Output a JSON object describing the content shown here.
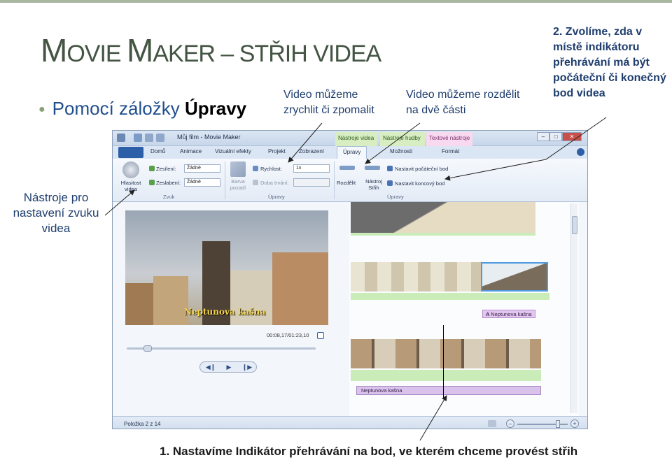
{
  "slide": {
    "title_parts": [
      "M",
      "OVIE ",
      "M",
      "AKER – ",
      "STŘIH VIDEA"
    ],
    "bullet_pre": "Pomocí záložky ",
    "bullet_bold": "Úpravy",
    "annotations": {
      "speed": "Video můžeme zrychlit či zpomalit",
      "split": "Video můžeme rozdělit na dvě části",
      "trim": "2. Zvolíme, zda v místě indikátoru přehrávání má být počáteční či konečný bod videa",
      "audio": "Nástroje pro nastavení zvuku videa",
      "playhead": "1. Nastavíme Indikátor přehrávání na bod, ve kterém chceme provést střih"
    }
  },
  "window": {
    "title": "Můj film - Movie Maker",
    "context_tabs": [
      "Nástroje videa",
      "Nástroje hudby",
      "Textové nástroje"
    ],
    "tabs": [
      "Domů",
      "Animace",
      "Vizuální efekty",
      "Projekt",
      "Zobrazení",
      "Úpravy",
      "Možnosti",
      "Formát"
    ],
    "active_tab": "Úpravy",
    "ribbon": {
      "volume_label": "Hlasitost videa",
      "fade_in_label": "Zesílení:",
      "fade_in_value": "Žádné",
      "fade_out_label": "Zeslabení:",
      "fade_out_value": "Žádné",
      "group_sound": "Zvuk",
      "bg_color_label": "Barva pozadí",
      "speed_label": "Rychlost:",
      "speed_value": "1x",
      "duration_label": "Doba trvání:",
      "group_edit": "Úpravy",
      "split_label": "Rozdělit",
      "trim_tool_label": "Nástroj Střih",
      "set_start": "Nastavit počáteční bod",
      "set_end": "Nastavit koncový bod"
    },
    "preview": {
      "caption": "Neptunova kašna",
      "timecode": "00:08,17/01:23,10"
    },
    "storyboard": {
      "text_label": "Neptunova kašna",
      "clip_caption": "Neptunova kašna"
    },
    "status": {
      "item_text": "Položka 2 z 14"
    },
    "zoom_level": 0.8
  }
}
